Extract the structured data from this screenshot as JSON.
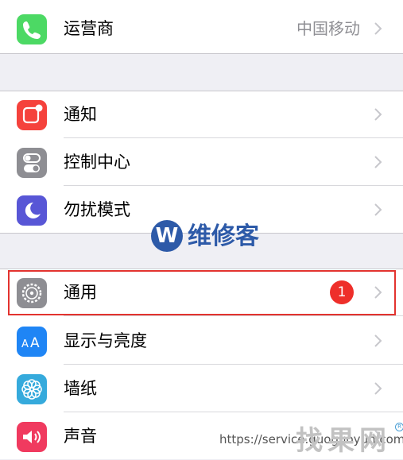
{
  "settings": {
    "carrier": {
      "label": "运营商",
      "value": "中国移动",
      "icon": "phone-icon",
      "color": "#4cd964"
    },
    "notifications": {
      "label": "通知",
      "icon": "notification-icon",
      "color": "#f5423c"
    },
    "control_center": {
      "label": "控制中心",
      "icon": "switches-icon",
      "color": "#8e8e93"
    },
    "do_not_disturb": {
      "label": "勿扰模式",
      "icon": "moon-icon",
      "color": "#5856d6"
    },
    "general": {
      "label": "通用",
      "badge": "1",
      "icon": "gear-icon",
      "color": "#8e8e93"
    },
    "display": {
      "label": "显示与亮度",
      "icon": "text-size-icon",
      "color": "#1f85f5"
    },
    "wallpaper": {
      "label": "墙纸",
      "icon": "flower-icon",
      "color": "#35aadc"
    },
    "sounds": {
      "label": "声音",
      "icon": "speaker-icon",
      "color": "#f03a5f"
    }
  },
  "watermark": {
    "mark": "W",
    "text": "维修客"
  },
  "footer": {
    "url": "https://service.guoguoyun.com",
    "logo": "找果网"
  }
}
